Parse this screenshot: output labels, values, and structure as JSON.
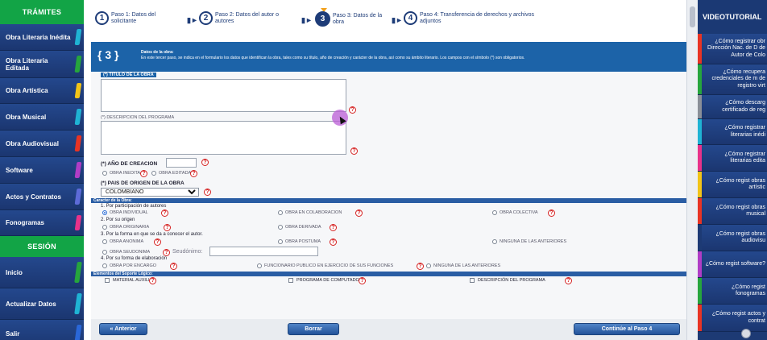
{
  "sidebar": {
    "header": "TRÁMITES",
    "items": [
      {
        "label": "Obra Literaria Inédita",
        "color": "#1fb3d4"
      },
      {
        "label": "Obra Literaria Editada",
        "color": "#26a53d"
      },
      {
        "label": "Obra Artística",
        "color": "#f2c418"
      },
      {
        "label": "Obra Musical",
        "color": "#1fb3d4"
      },
      {
        "label": "Obra Audiovisual",
        "color": "#e83424"
      },
      {
        "label": "Software",
        "color": "#b03dc6"
      },
      {
        "label": "Actos y Contratos",
        "color": "#5d6bd8"
      },
      {
        "label": "Fonogramas",
        "color": "#e8328a"
      }
    ],
    "session_header": "SESIÓN",
    "session_items": [
      {
        "label": "Inicio",
        "color": "#26a53d"
      },
      {
        "label": "Actualizar Datos",
        "color": "#1fb3d4"
      },
      {
        "label": "Salir",
        "color": "#2a67d8"
      }
    ]
  },
  "steps": [
    {
      "num": "1",
      "line1": "Paso 1: Datos del",
      "line2": "solicitante"
    },
    {
      "num": "2",
      "line1": "Paso 2: Datos del autor o",
      "line2": "autores"
    },
    {
      "num": "3",
      "line1": "Paso 3: Datos de la",
      "line2": "obra"
    },
    {
      "num": "4",
      "line1": "Paso 4: Transferencia de derechos y archivos",
      "line2": "adjuntos"
    }
  ],
  "banner": {
    "num": "3",
    "title": "Datos de la obra:",
    "text": "En este tercer paso, se indica en el formulario los datos que identifican la obra, tales como su título, año de creación y carácter de la obra, así como su ámbito literario. Los campos con el símbolo (*) son obligatorios."
  },
  "form": {
    "titulo_label": "(*) TITULO DE LA OBRA",
    "descripcion_label": "(*) DESCRIPCION DEL PROGRAMA",
    "anio_label": "(*) AÑO DE CREACION",
    "anio_value": "",
    "obra_inedita": "OBRA INEDITA",
    "obra_editada": "OBRA EDITADA",
    "pais_label": "(*) PAIS DE ORIGEN DE LA OBRA",
    "pais_value": "COLOMBIANO",
    "caracter_header": "Caracter de la Obra:",
    "q1": "1. Por participación de autores",
    "q1_opts": [
      "OBRA INDIVIDUAL",
      "OBRA EN COLABORACION",
      "OBRA COLECTIVA"
    ],
    "q2": "2. Por su origen",
    "q2_opts": [
      "OBRA ORIGINARIA",
      "OBRA DERIVADA"
    ],
    "q3": "3. Por la forma en que se da a conocer el autor.",
    "q3_opts": [
      "OBRA ANONIMA",
      "OBRA POSTUMA",
      "NINGUNA DE LAS ANTERIORES",
      "OBRA SEUDONIMA"
    ],
    "seudonimo_label": "Seudónimo:",
    "seudonimo_value": "",
    "q4": "4. Por su forma de elaboración",
    "q4_opts": [
      "OBRA POR ENCARGO",
      "FUNCIONARIO PUBLICO EN EJERCICIO DE SUS FUNCIONES",
      "NINGUNA DE LAS ANTERIORES"
    ],
    "soporte_header": "Elementos del Soporte Lógico:",
    "soporte_opts": [
      "MATERIAL AUXILIAR",
      "PROGRAMA DE COMPUTADOR",
      "DESCRIPCIÓN DEL PROGRAMA"
    ]
  },
  "buttons": {
    "prev": "Anterior",
    "clear": "Borrar",
    "next": "Continúe al Paso 4"
  },
  "rightbar": {
    "header": "VIDEOTUTORIAL",
    "items": [
      {
        "text": "¿Cómo registrar obr Dirección Nac. de D de Autor de Colo",
        "color": "#e83424"
      },
      {
        "text": "¿Cómo recupera credenciales de m de registro virt",
        "color": "#26a53d"
      },
      {
        "text": "¿Cómo descarg certificado de reg",
        "color": "#8a8f98"
      },
      {
        "text": "¿Cómo registrar literarias inédi",
        "color": "#1fb3d4"
      },
      {
        "text": "¿Cómo registrar literarias edita",
        "color": "#e8328a"
      },
      {
        "text": "¿Cómo regist obras artístic",
        "color": "#f2c418"
      },
      {
        "text": "¿Cómo regist obras musical",
        "color": "#e83424"
      },
      {
        "text": "¿Cómo regist obras audiovisu",
        "color": "#1d3a74"
      },
      {
        "text": "¿Cómo regist software?",
        "color": "#b03dc6"
      },
      {
        "text": "¿Cómo regist fonogramas",
        "color": "#26a53d"
      },
      {
        "text": "¿Cómo regist actos y contrat",
        "color": "#e83424"
      }
    ]
  }
}
